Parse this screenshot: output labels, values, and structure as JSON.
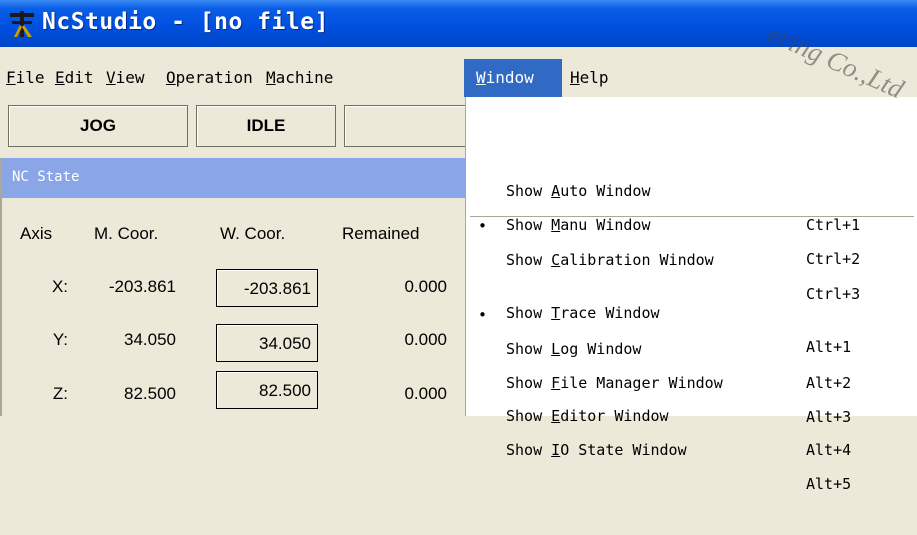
{
  "window": {
    "title": "NcStudio - [no file]",
    "watermark": "ering Co.,Ltd"
  },
  "menubar": [
    {
      "pre": "",
      "key": "F",
      "post": "ile"
    },
    {
      "pre": "",
      "key": "E",
      "post": "dit"
    },
    {
      "pre": "",
      "key": "V",
      "post": "iew"
    },
    {
      "pre": "",
      "key": "O",
      "post": "peration"
    },
    {
      "pre": "",
      "key": "M",
      "post": "achine"
    },
    {
      "pre": "",
      "key": "W",
      "post": "indow"
    },
    {
      "pre": "",
      "key": "H",
      "post": "elp"
    }
  ],
  "status": {
    "mode": "JOG",
    "state": "IDLE",
    "extra": ""
  },
  "nc_state": {
    "title": "NC State",
    "columns": {
      "axis": "Axis",
      "mcoor": "M. Coor.",
      "wcoor": "W. Coor.",
      "remained": "Remained"
    },
    "rows": [
      {
        "axis": "X:",
        "mcoor": "-203.861",
        "wcoor": "-203.861",
        "remained": "0.000"
      },
      {
        "axis": "Y:",
        "mcoor": "34.050",
        "wcoor": "34.050",
        "remained": "0.000"
      },
      {
        "axis": "Z:",
        "mcoor": "82.500",
        "wcoor": "82.500",
        "remained": "0.000"
      }
    ]
  },
  "window_menu": {
    "items": [
      {
        "bullet": "",
        "pre": "Show ",
        "key": "A",
        "post": "uto Window",
        "accel": "Ctrl+1"
      },
      {
        "bullet": "",
        "pre": "Show ",
        "key": "M",
        "post": "anu Window",
        "accel": "Ctrl+2"
      },
      {
        "bullet": "•",
        "pre": "Show ",
        "key": "C",
        "post": "alibration Window",
        "accel": "Ctrl+3"
      },
      {
        "bullet": "",
        "pre": "Show ",
        "key": "T",
        "post": "race Window",
        "accel": "Alt+1"
      },
      {
        "bullet": "•",
        "pre": "Show ",
        "key": "L",
        "post": "og Window",
        "accel": "Alt+2"
      },
      {
        "bullet": "",
        "pre": "Show ",
        "key": "F",
        "post": "ile Manager Window",
        "accel": "Alt+3"
      },
      {
        "bullet": "",
        "pre": "Show ",
        "key": "E",
        "post": "ditor Window",
        "accel": "Alt+4"
      },
      {
        "bullet": "",
        "pre": "Show ",
        "key": "I",
        "post": "O State Window",
        "accel": "Alt+5"
      }
    ]
  }
}
